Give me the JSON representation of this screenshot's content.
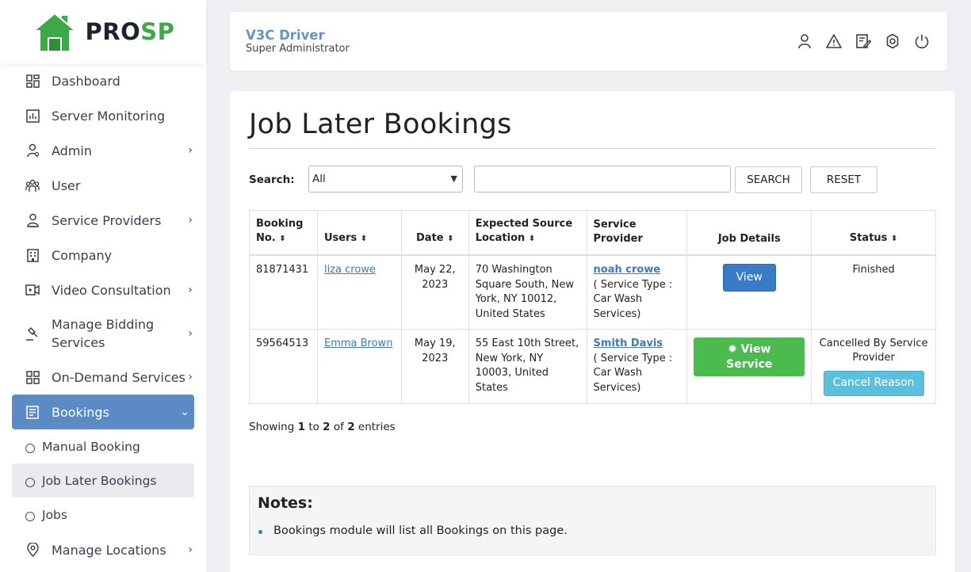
{
  "brand": {
    "part1": "PRO",
    "part2": "SP",
    "accent": "#3da847"
  },
  "sidebar": {
    "items": [
      {
        "label": "Dashboard",
        "icon": "dashboard-icon",
        "chevron": false
      },
      {
        "label": "Server Monitoring",
        "icon": "chart-icon",
        "chevron": false
      },
      {
        "label": "Admin",
        "icon": "admin-icon",
        "chevron": true
      },
      {
        "label": "User",
        "icon": "users-icon",
        "chevron": false
      },
      {
        "label": "Service Providers",
        "icon": "provider-icon",
        "chevron": true
      },
      {
        "label": "Company",
        "icon": "building-icon",
        "chevron": false
      },
      {
        "label": "Video Consultation",
        "icon": "video-icon",
        "chevron": true
      },
      {
        "label_line1": "Manage Bidding",
        "label_line2": "Services",
        "icon": "gavel-icon",
        "chevron": true
      },
      {
        "label": "On-Demand Services",
        "icon": "grid-icon",
        "chevron": true
      },
      {
        "label": "Bookings",
        "icon": "bookings-icon",
        "chevron": true,
        "active": true
      }
    ],
    "sub_items": [
      {
        "label": "Manual Booking"
      },
      {
        "label": "Job Later Bookings",
        "current": true
      },
      {
        "label": "Jobs"
      }
    ],
    "last_item": {
      "label": "Manage Locations",
      "icon": "location-icon",
      "chevron": true
    }
  },
  "header": {
    "name": "V3C Driver",
    "role": "Super Administrator"
  },
  "page": {
    "title": "Job Later Bookings"
  },
  "search": {
    "label": "Search:",
    "select_value": "All",
    "input_value": "",
    "search_button": "SEARCH",
    "reset_button": "RESET"
  },
  "table": {
    "headers": {
      "booking_no_1": "Booking",
      "booking_no_2": "No.",
      "users": "Users",
      "date": "Date",
      "location_1": "Expected Source",
      "location_2": "Location",
      "provider": "Service Provider",
      "job_details": "Job Details",
      "status": "Status"
    },
    "rows": [
      {
        "booking_no": "81871431",
        "user": "liza crowe",
        "date_1": "May 22,",
        "date_2": "2023",
        "location": "70 Washington Square South, New York, NY 10012, United States",
        "provider_name": "noah crowe",
        "service_type": "( Service Type : Car Wash Services)",
        "job_button": "View",
        "status": "Finished"
      },
      {
        "booking_no": "59564513",
        "user": "Emma Brown",
        "date_1": "May 19,",
        "date_2": "2023",
        "location": "55 East 10th Street, New York, NY 10003, United States",
        "provider_name": "Smith Davis",
        "service_type": "( Service Type : Car Wash Services)",
        "job_button": "View Service",
        "status": "Cancelled By Service Provider",
        "status_button": "Cancel Reason"
      }
    ]
  },
  "pagination": {
    "prefix": "Showing",
    "from": "1",
    "to_word": "to",
    "to": "2",
    "of_word": "of",
    "total": "2",
    "suffix": "entries"
  },
  "notes": {
    "title": "Notes:",
    "items": [
      "Bookings module will list all Bookings on this page."
    ]
  },
  "colors": {
    "sidebar_active": "#5b8ac4",
    "link": "#3f76c6",
    "view_button": "#3a7bc8",
    "service_button": "#4cbb4f",
    "cancel_button": "#5bc0de"
  }
}
